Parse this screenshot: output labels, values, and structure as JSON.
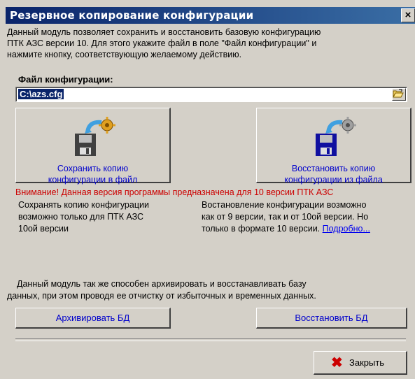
{
  "window": {
    "title": "Резервное копирование конфигурации",
    "close_glyph": "×"
  },
  "intro": {
    "line1": "Данный модуль позволяет сохранить и восстановить базовую конфигурацию",
    "line2": "ПТК АЗС версии 10. Для этого укажите файл в поле \"Файл конфигурации\" и",
    "line3": "нажмите кнопку, соответствующую желаемому действию."
  },
  "file": {
    "label": "Файл конфигурации:",
    "value": "C:\\azs.cfg",
    "browse_icon": "folder-open-icon"
  },
  "save_button": {
    "line1": "Сохранить копию",
    "line2": "конфигурации в файл",
    "icon": "floppy-save-icon"
  },
  "restore_button": {
    "line1": "Восстановить копию",
    "line2": "конфигурации из файла",
    "icon": "floppy-restore-icon"
  },
  "warning": "Внимание! Данная версия программы предназначена для 10 версии ПТК АЗС",
  "note_save": {
    "line1": "Сохранять копию конфигурации",
    "line2": "возможно только для ПТК АЗС",
    "line3": "10ой версии"
  },
  "note_restore": {
    "line1": "Востановление конфигурации возможно",
    "line2": "как от 9 версии, так и от 10ой версии. Но",
    "line3": "только в формате 10 версии.",
    "link": "Подробно..."
  },
  "db_text": {
    "line1": "Данный модуль так же способен архивировать и восстанавливать базу",
    "line2": "данных, при этом проводя ее отчистку от избыточных и временных данных."
  },
  "archive_button": "Архивировать БД",
  "restore_db_button": "Восстановить БД",
  "close_button": "Закрыть",
  "colors": {
    "titlebar": "#0a246a",
    "face": "#d4d0c8",
    "warning": "#cc0000",
    "link": "#0000cc"
  }
}
